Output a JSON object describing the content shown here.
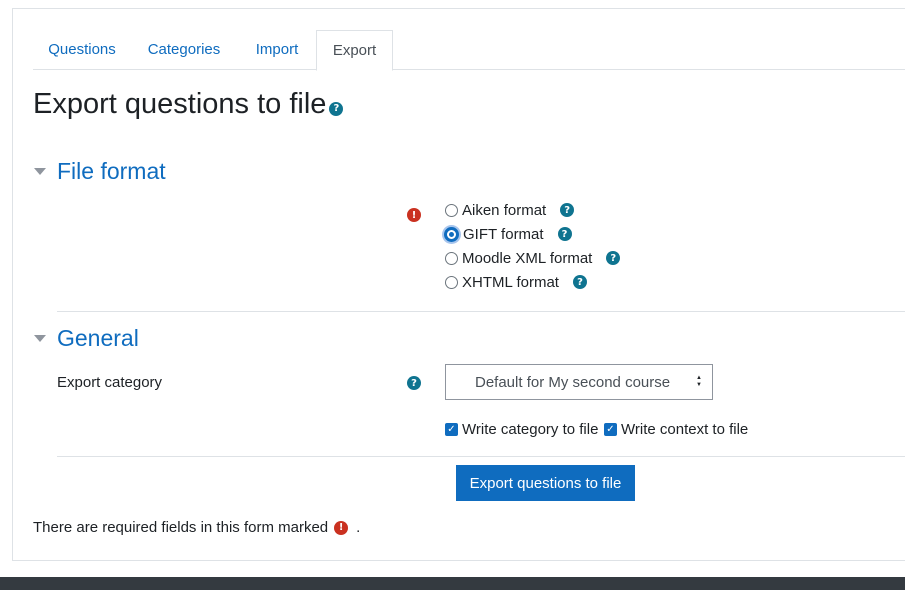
{
  "tabs": [
    {
      "label": "Questions",
      "active": false
    },
    {
      "label": "Categories",
      "active": false
    },
    {
      "label": "Import",
      "active": false
    },
    {
      "label": "Export",
      "active": true
    }
  ],
  "page": {
    "title": "Export questions to file",
    "help_glyph": "?"
  },
  "sections": {
    "file_format": {
      "title": "File format",
      "required_glyph": "!",
      "options": [
        {
          "label": "Aiken format",
          "checked": false
        },
        {
          "label": "GIFT format",
          "checked": true
        },
        {
          "label": "Moodle XML format",
          "checked": false
        },
        {
          "label": "XHTML format",
          "checked": false
        }
      ]
    },
    "general": {
      "title": "General",
      "export_category_label": "Export category",
      "export_category_value": "Default for My second course",
      "checkboxes": [
        {
          "label": "Write category to file",
          "checked": true
        },
        {
          "label": "Write context to file",
          "checked": true
        }
      ]
    }
  },
  "submit_label": "Export questions to file",
  "required_note": {
    "text": "There are required fields in this form marked",
    "suffix": "."
  },
  "glyphs": {
    "help": "?",
    "required": "!",
    "check": "✓",
    "updown_up": "▲",
    "updown_down": "▼"
  },
  "colors": {
    "accent": "#0f6cbf",
    "help": "#0f7490",
    "required": "#ca3120",
    "footer": "#343a40"
  }
}
